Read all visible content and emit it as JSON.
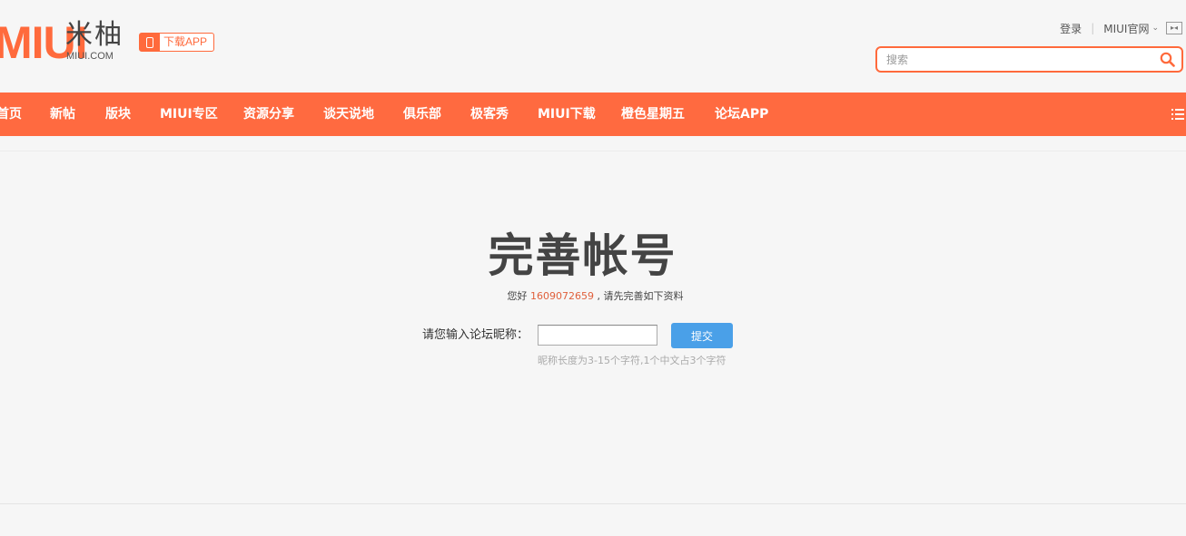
{
  "header": {
    "logo_text": "MIUI",
    "logo_cn": "米柚",
    "logo_domain": "MIUI.COM",
    "download_app_label": "下载APP",
    "top_links": {
      "login": "登录",
      "official_site": "MIUI官网"
    },
    "search": {
      "placeholder": "搜索",
      "value": ""
    }
  },
  "nav": {
    "items": [
      {
        "label": "首页"
      },
      {
        "label": "新帖"
      },
      {
        "label": "版块"
      },
      {
        "label": "MIUI专区"
      },
      {
        "label": "资源分享"
      },
      {
        "label": "谈天说地"
      },
      {
        "label": "俱乐部"
      },
      {
        "label": "极客秀"
      },
      {
        "label": "MIUI下载"
      },
      {
        "label": "橙色星期五"
      },
      {
        "label": "论坛APP"
      }
    ]
  },
  "main": {
    "title": "完善帐号",
    "greeting_prefix": "您好",
    "user_id": "1609072659",
    "greeting_suffix": ", 请先完善如下资料",
    "form": {
      "label": "请您输入论坛昵称：",
      "nickname_value": "",
      "submit_label": "提交",
      "hint": "昵称长度为3-15个字符,1个中文占3个字符"
    }
  },
  "colors": {
    "brand": "#ff6a40",
    "button": "#4aa0e8",
    "uid": "#e0603c"
  }
}
